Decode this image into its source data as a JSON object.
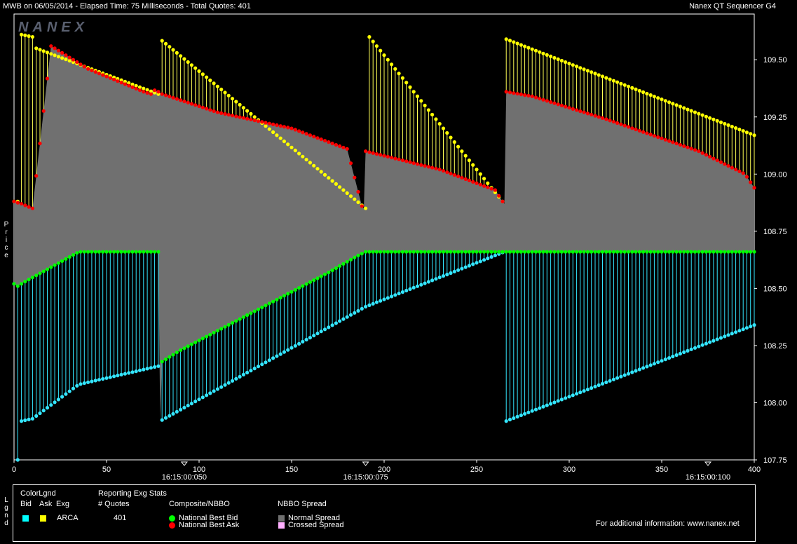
{
  "header": {
    "left": "MWB on 06/05/2014  -  Elapsed Time: 75 Milliseconds  -  Total Quotes: 401",
    "right": "Nanex QT Sequencer G4",
    "watermark": "NANEX"
  },
  "side_labels": {
    "price": "Price",
    "legend": "Lgnd"
  },
  "chart_data": {
    "type": "line",
    "ylabel": "Price",
    "xlim": [
      0,
      400
    ],
    "ylim": [
      107.75,
      109.7
    ],
    "x_ticks": [
      0,
      50,
      100,
      150,
      200,
      250,
      300,
      350,
      400
    ],
    "y_ticks": [
      "107.75",
      "108.00",
      "108.25",
      "108.50",
      "108.75",
      "109.00",
      "109.25",
      "109.50"
    ],
    "time_labels": [
      {
        "x": 92,
        "text": "16:15:00:050"
      },
      {
        "x": 190,
        "text": "16:15:00:075"
      },
      {
        "x": 375,
        "text": "16:15:00:100"
      }
    ],
    "series": [
      {
        "name": "National Best Ask",
        "color": "#ff0000",
        "x": [
          0,
          4,
          10,
          20,
          40,
          70,
          74,
          75,
          78,
          80,
          110,
          150,
          180,
          188,
          189,
          190,
          195,
          230,
          260,
          264,
          265,
          266,
          280,
          320,
          370,
          395,
          400
        ],
        "y": [
          108.88,
          108.87,
          108.85,
          109.56,
          109.46,
          109.36,
          109.35,
          109.37,
          109.36,
          109.35,
          109.27,
          109.2,
          109.11,
          108.86,
          108.85,
          109.1,
          109.09,
          109.02,
          108.93,
          108.88,
          108.87,
          109.36,
          109.34,
          109.24,
          109.1,
          109.0,
          108.94
        ]
      },
      {
        "name": "National Best Bid",
        "color": "#00ff00",
        "x": [
          0,
          2,
          4,
          6,
          35,
          78,
          79,
          80,
          84,
          90,
          170,
          185,
          190,
          264,
          265,
          266,
          270,
          290,
          310,
          350,
          390,
          400
        ],
        "y": [
          108.52,
          108.51,
          108.52,
          108.53,
          108.66,
          108.66,
          107.92,
          108.18,
          108.2,
          108.23,
          108.57,
          108.64,
          108.66,
          108.66,
          108.66,
          108.66,
          108.66,
          108.66,
          108.66,
          108.66,
          108.66,
          108.66
        ]
      },
      {
        "name": "ARCA Ask",
        "color": "#ffff00",
        "x": [
          0,
          3,
          4,
          10,
          11,
          12,
          78,
          79,
          190,
          191,
          265,
          266,
          400
        ],
        "y": [
          108.88,
          108.88,
          109.61,
          109.6,
          108.85,
          109.55,
          109.35,
          109.59,
          108.85,
          109.61,
          108.87,
          109.59,
          109.17
        ]
      },
      {
        "name": "ARCA Bid",
        "color": "#33e6ff",
        "x": [
          0,
          2,
          3,
          4,
          10,
          35,
          78,
          79,
          190,
          265,
          266,
          400
        ],
        "y": [
          108.52,
          107.75,
          107.92,
          107.92,
          107.93,
          108.08,
          108.16,
          107.92,
          108.42,
          108.66,
          107.92,
          108.34
        ]
      }
    ]
  },
  "legend": {
    "color_lgnd": "ColorLgnd",
    "bid": "Bid",
    "ask": "Ask",
    "exg": "Exg",
    "exchange": "ARCA",
    "bid_color": "#00ffff",
    "ask_color": "#ffff00",
    "reporting": "Reporting Exg Stats",
    "quotes_label": "# Quotes",
    "quotes_value": "401",
    "composite": "Composite/NBBO",
    "nbb": "National Best Bid",
    "nbo": "National Best Ask",
    "nbbo_spread": "NBBO Spread",
    "normal_spread": "Normal Spread",
    "crossed_spread": "Crossed Spread",
    "info": "For additional information: www.nanex.net"
  }
}
